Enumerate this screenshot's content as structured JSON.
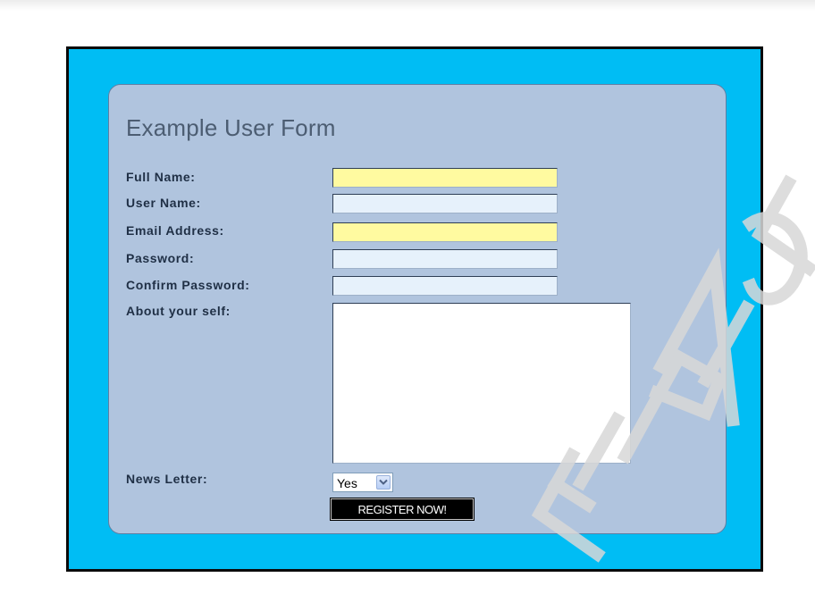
{
  "form": {
    "title": "Example User Form",
    "fields": [
      {
        "label": "Full Name:",
        "value": "",
        "style": "required",
        "fill_color": "#fffaa0"
      },
      {
        "label": "User Name:",
        "value": "",
        "style": "optional",
        "fill_color": "#e6f1fb"
      },
      {
        "label": "Email Address:",
        "value": "",
        "style": "required",
        "fill_color": "#fffaa0"
      },
      {
        "label": "Password:",
        "value": "",
        "style": "optional",
        "fill_color": "#e6f1fb"
      },
      {
        "label": "Confirm Password:",
        "value": "",
        "style": "optional",
        "fill_color": "#e6f1fb"
      }
    ],
    "about": {
      "label": "About your self:",
      "value": ""
    },
    "newsletter": {
      "label": "News Letter:",
      "selected": "Yes"
    },
    "submit_label": "REGISTER NOW!"
  },
  "colors": {
    "frame_background": "#00bdf4",
    "frame_border": "#0b0b0b",
    "panel_background": "#b0c4de",
    "title_text": "#4c5d72",
    "label_text": "#1f2f45",
    "button_background": "#000000",
    "button_text": "#ffffff"
  },
  "icons": {
    "select_arrow": "chevron-down-icon"
  },
  "watermark": {
    "glyphs": [
      "Ε",
      "Ι",
      "Ρ",
      "Α",
      "Ι",
      "Ο",
      "Σ"
    ]
  }
}
